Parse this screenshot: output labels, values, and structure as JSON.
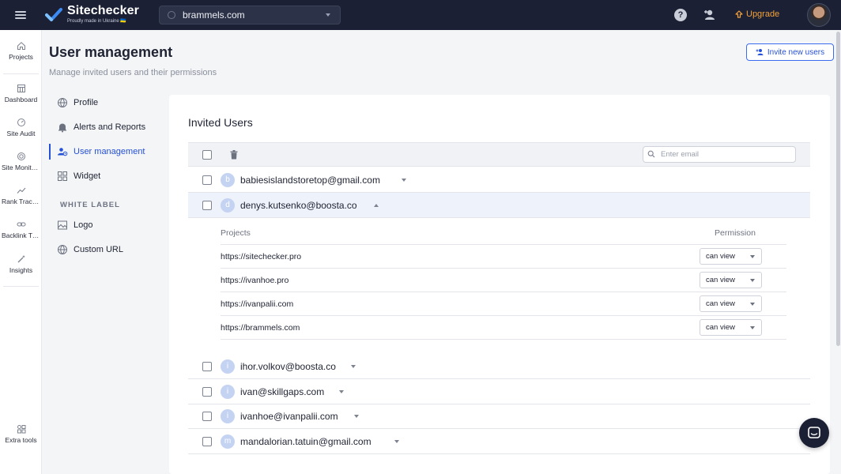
{
  "brand": {
    "name": "Sitechecker",
    "tagline": "Proudly made in Ukraine 🇺🇦"
  },
  "topbar": {
    "domain": "brammels.com",
    "upgrade_label": "Upgrade"
  },
  "rail": {
    "items": [
      {
        "label": "Projects",
        "icon": "home-icon"
      },
      {
        "label": "Dashboard",
        "icon": "dashboard-icon"
      },
      {
        "label": "Site Audit",
        "icon": "audit-gauge-icon"
      },
      {
        "label": "Site Monitoring",
        "icon": "monitoring-radar-icon"
      },
      {
        "label": "Rank Tracker",
        "icon": "rank-trend-icon"
      },
      {
        "label": "Backlink Tracker",
        "icon": "link-icon"
      },
      {
        "label": "Insights",
        "icon": "magic-wand-icon"
      },
      {
        "label": "Extra tools",
        "icon": "tools-grid-icon"
      }
    ]
  },
  "page": {
    "title": "User management",
    "subtitle": "Manage invited users and their permissions",
    "invite_label": "Invite new users"
  },
  "settings_nav": {
    "items": [
      {
        "label": "Profile",
        "icon": "globe-icon"
      },
      {
        "label": "Alerts and Reports",
        "icon": "bell-icon"
      },
      {
        "label": "User management",
        "icon": "users-icon"
      },
      {
        "label": "Widget",
        "icon": "widget-grid-icon"
      }
    ],
    "white_label_heading": "WHITE LABEL",
    "white_label_items": [
      {
        "label": "Logo",
        "icon": "image-icon"
      },
      {
        "label": "Custom URL",
        "icon": "globe-icon"
      }
    ]
  },
  "invited": {
    "title": "Invited Users",
    "search_placeholder": "Enter email",
    "users": [
      {
        "initial": "b",
        "email": "babiesislandstoretop@gmail.com"
      },
      {
        "initial": "d",
        "email": "denys.kutsenko@boosta.co"
      },
      {
        "initial": "i",
        "email": "ihor.volkov@boosta.co"
      },
      {
        "initial": "i",
        "email": "ivan@skillgaps.com"
      },
      {
        "initial": "i",
        "email": "ivanhoe@ivanpalii.com"
      },
      {
        "initial": "m",
        "email": "mandalorian.tatuin@gmail.com"
      }
    ],
    "expanded": {
      "projects_header": "Projects",
      "permission_header": "Permission",
      "rows": [
        {
          "url": "https://sitechecker.pro",
          "permission": "can view"
        },
        {
          "url": "https://ivanhoe.pro",
          "permission": "can view"
        },
        {
          "url": "https://ivanpalii.com",
          "permission": "can view"
        },
        {
          "url": "https://brammels.com",
          "permission": "can view"
        }
      ]
    }
  }
}
